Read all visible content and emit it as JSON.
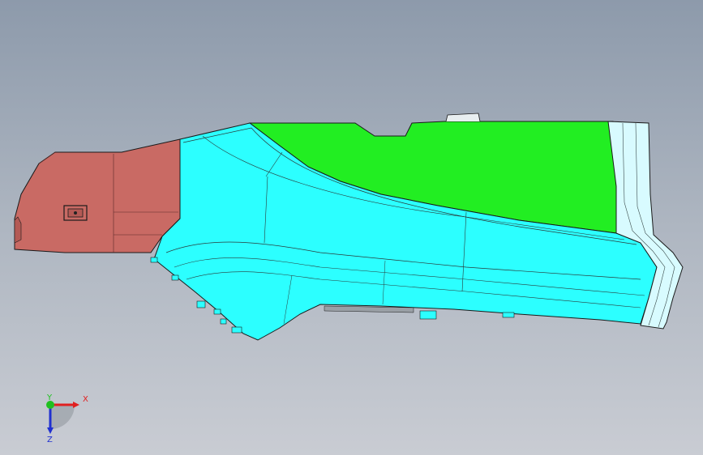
{
  "viewport": {
    "background_top": "#8d9aab",
    "background_bottom": "#c9ccd3"
  },
  "model": {
    "colors": {
      "dark_red_part": "#c96a64",
      "cyan_part": "#2cffff",
      "green_part": "#22ee22",
      "pale_cyan_part": "#d8fbff",
      "edge": "#1a1a1a"
    }
  },
  "triad": {
    "x_label": "X",
    "y_label": "Y",
    "z_label": "Z",
    "x_color": "#e02020",
    "y_color": "#20c020",
    "z_color": "#2030d0"
  }
}
